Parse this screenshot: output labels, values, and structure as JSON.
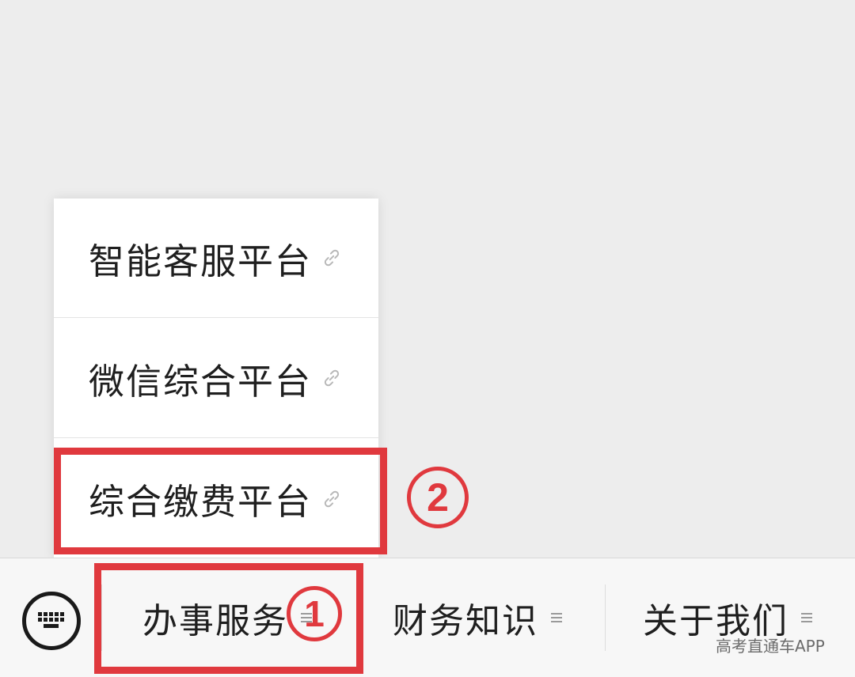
{
  "popup_menu": {
    "items": [
      {
        "label": "智能客服平台",
        "icon": "link-icon"
      },
      {
        "label": "微信综合平台",
        "icon": "link-icon"
      },
      {
        "label": "综合缴费平台",
        "icon": "link-icon"
      }
    ]
  },
  "bottom_menu": {
    "keyboard_icon": "keyboard-icon",
    "tabs": [
      {
        "label": "办事服务",
        "icon": "menu-lines-icon"
      },
      {
        "label": "财务知识",
        "icon": "menu-lines-icon"
      },
      {
        "label": "关于我们",
        "icon": "menu-lines-icon"
      }
    ]
  },
  "annotations": {
    "step_1": "1",
    "step_2": "2",
    "highlight_color": "#e0393e"
  },
  "watermark": "高考直通车APP"
}
